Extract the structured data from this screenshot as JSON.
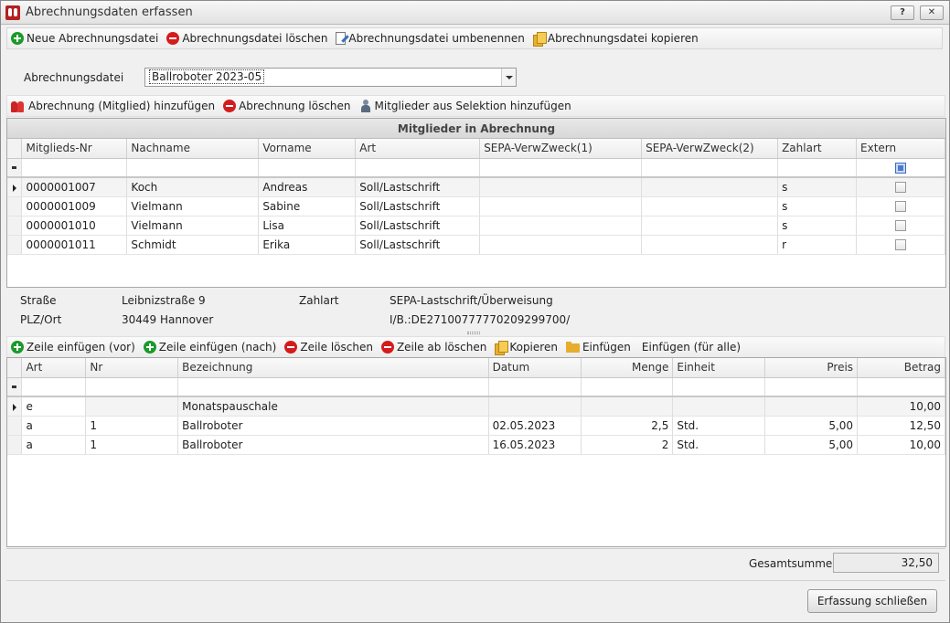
{
  "window": {
    "title": "Abrechnungsdaten erfassen",
    "help_label": "?",
    "close_label": "✕"
  },
  "file_toolbar": {
    "new": "Neue Abrechnungsdatei",
    "delete": "Abrechnungsdatei löschen",
    "rename": "Abrechnungsdatei umbenennen",
    "copy": "Abrechnungsdatei kopieren"
  },
  "file_select": {
    "label": "Abrechnungsdatei",
    "value": "Ballroboter 2023-05"
  },
  "member_toolbar": {
    "add": "Abrechnung (Mitglied) hinzufügen",
    "delete": "Abrechnung löschen",
    "add_selection": "Mitglieder aus Selektion hinzufügen"
  },
  "members_grid": {
    "caption": "Mitglieder in Abrechnung",
    "columns": [
      "Mitglieds-Nr",
      "Nachname",
      "Vorname",
      "Art",
      "SEPA-VerwZweck(1)",
      "SEPA-VerwZweck(2)",
      "Zahlart",
      "Extern"
    ],
    "rows": [
      {
        "nr": "0000001007",
        "nachname": "Koch",
        "vorname": "Andreas",
        "art": "Soll/Lastschrift",
        "z1": "",
        "z2": "",
        "zahlart": "s"
      },
      {
        "nr": "0000001009",
        "nachname": "Vielmann",
        "vorname": "Sabine",
        "art": "Soll/Lastschrift",
        "z1": "",
        "z2": "",
        "zahlart": "s"
      },
      {
        "nr": "0000001010",
        "nachname": "Vielmann",
        "vorname": "Lisa",
        "art": "Soll/Lastschrift",
        "z1": "",
        "z2": "",
        "zahlart": "s"
      },
      {
        "nr": "0000001011",
        "nachname": "Schmidt",
        "vorname": "Erika",
        "art": "Soll/Lastschrift",
        "z1": "",
        "z2": "",
        "zahlart": "r"
      }
    ]
  },
  "detail": {
    "strasse_label": "Straße",
    "strasse": "Leibnizstraße 9",
    "plz_label": "PLZ/Ort",
    "plz": "30449 Hannover",
    "zahlart_label": "Zahlart",
    "zahlart": "SEPA-Lastschrift/Überweisung",
    "iban": "I/B.:DE27100777770209299700/"
  },
  "line_toolbar": {
    "insert_before": "Zeile einfügen (vor)",
    "insert_after": "Zeile einfügen (nach)",
    "delete": "Zeile löschen",
    "delete_from": "Zeile ab löschen",
    "copy": "Kopieren",
    "paste": "Einfügen",
    "paste_all": "Einfügen (für alle)"
  },
  "lines_grid": {
    "columns": [
      "Art",
      "Nr",
      "Bezeichnung",
      "Datum",
      "Menge",
      "Einheit",
      "Preis",
      "Betrag"
    ],
    "rows": [
      {
        "art": "e",
        "nr": "",
        "bez": "Monatspauschale",
        "datum": "",
        "menge": "",
        "einheit": "",
        "preis": "",
        "betrag": "10,00"
      },
      {
        "art": "a",
        "nr": "1",
        "bez": "Ballroboter",
        "datum": "02.05.2023",
        "menge": "2,5",
        "einheit": "Std.",
        "preis": "5,00",
        "betrag": "12,50"
      },
      {
        "art": "a",
        "nr": "1",
        "bez": "Ballroboter",
        "datum": "16.05.2023",
        "menge": "2",
        "einheit": "Std.",
        "preis": "5,00",
        "betrag": "10,00"
      }
    ]
  },
  "total": {
    "label": "Gesamtsumme",
    "value": "32,50"
  },
  "close_button": "Erfassung schließen"
}
